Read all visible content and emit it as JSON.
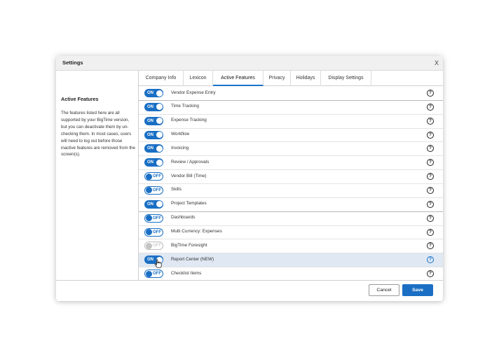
{
  "dialog": {
    "title": "Settings",
    "close_label": "X"
  },
  "sidebar": {
    "title": "Active Features",
    "description": "The features listed here are all supported by your BigTime version, but you can deactivate them by un-checking them. In most cases, users will need to log out before those inactive features are removed from the screen(s)."
  },
  "tabs": [
    {
      "label": "Company Info",
      "active": false
    },
    {
      "label": "Lexicon",
      "active": false
    },
    {
      "label": "Active Features",
      "active": true
    },
    {
      "label": "Privacy",
      "active": false
    },
    {
      "label": "Holidays",
      "active": false
    },
    {
      "label": "Display Settings",
      "active": false
    }
  ],
  "toggle_labels": {
    "on": "ON",
    "off": "OFF"
  },
  "help_glyph": "?",
  "features": [
    {
      "name": "Vendor Expense Entry",
      "state": "on"
    },
    {
      "name": "Time Tracking",
      "state": "on"
    },
    {
      "name": "Expense Tracking",
      "state": "on"
    },
    {
      "name": "Workflow",
      "state": "on"
    },
    {
      "name": "Invoicing",
      "state": "on"
    },
    {
      "name": "Review / Approvals",
      "state": "on"
    },
    {
      "name": "Vendor Bill (Time)",
      "state": "off"
    },
    {
      "name": "Skills",
      "state": "off"
    },
    {
      "name": "Project Templates",
      "state": "on"
    },
    {
      "name": "Dashboards",
      "state": "off"
    },
    {
      "name": "Multi Currency: Expenses",
      "state": "off"
    },
    {
      "name": "BigTime Foresight",
      "state": "disabled"
    },
    {
      "name": "Report Center (NEW)",
      "state": "on",
      "highlighted": true
    },
    {
      "name": "Checklist Items",
      "state": "off"
    }
  ],
  "footer": {
    "cancel_label": "Cancel",
    "save_label": "Save"
  },
  "colors": {
    "accent": "#1a6fc4",
    "highlight_row": "#dfe8f3",
    "disabled": "#bdbdbd"
  }
}
